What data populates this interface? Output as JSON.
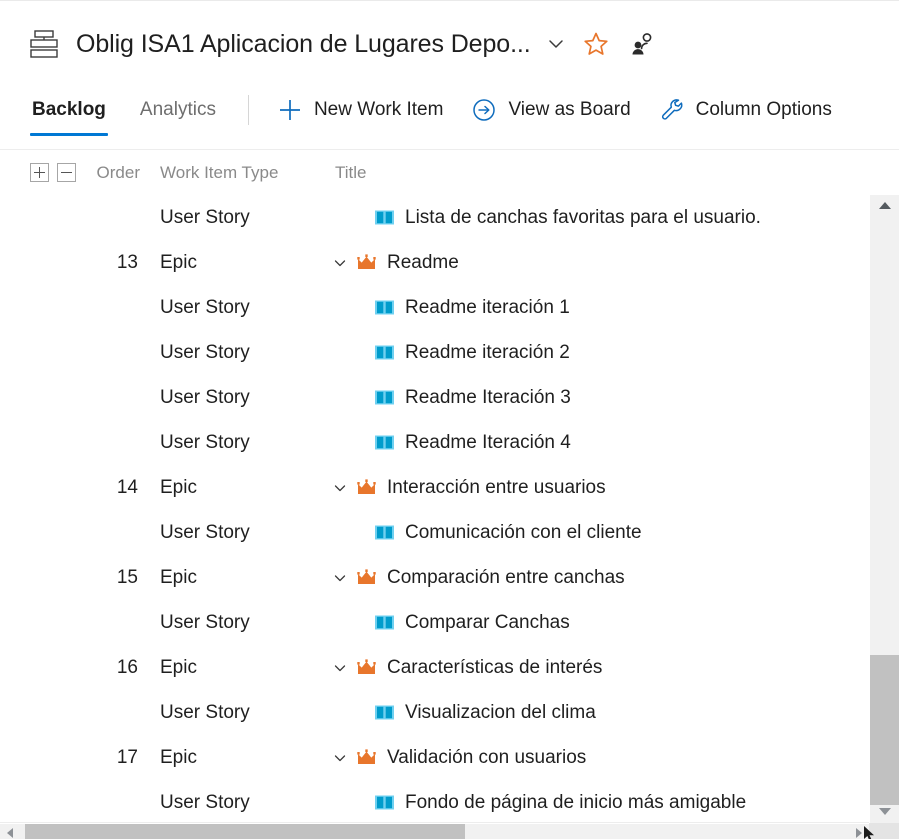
{
  "header": {
    "project_icon": "backlog-stack-icon",
    "title": "Oblig ISA1 Aplicacion de Lugares Depo...",
    "chevron_icon": "chevron-down-icon",
    "favorite_icon": "star-outline-icon",
    "team_icon": "people-icon",
    "favorite_color": "#E8762C"
  },
  "toolbar": {
    "pivots": [
      {
        "label": "Backlog",
        "selected": true
      },
      {
        "label": "Analytics",
        "selected": false
      }
    ],
    "commands": [
      {
        "label": "New Work Item",
        "icon": "plus-icon"
      },
      {
        "label": "View as Board",
        "icon": "circle-arrow-right-icon"
      },
      {
        "label": "Column Options",
        "icon": "wrench-icon"
      }
    ],
    "accent_color": "#0078D4"
  },
  "grid": {
    "expand_all_icon": "expand-all-plus-icon",
    "collapse_all_icon": "collapse-all-minus-icon",
    "columns": [
      {
        "key": "order",
        "label": "Order"
      },
      {
        "key": "type",
        "label": "Work Item Type"
      },
      {
        "key": "title",
        "label": "Title"
      }
    ],
    "rows": [
      {
        "order": "",
        "type": "User Story",
        "title": "Lista de canchas favoritas para el usuario.",
        "level": "story",
        "icon": "user-story-book-icon",
        "expanded": null
      },
      {
        "order": "13",
        "type": "Epic",
        "title": "Readme",
        "level": "epic",
        "icon": "epic-crown-icon",
        "expanded": true
      },
      {
        "order": "",
        "type": "User Story",
        "title": "Readme iteración 1",
        "level": "story",
        "icon": "user-story-book-icon",
        "expanded": null
      },
      {
        "order": "",
        "type": "User Story",
        "title": "Readme iteración 2",
        "level": "story",
        "icon": "user-story-book-icon",
        "expanded": null
      },
      {
        "order": "",
        "type": "User Story",
        "title": "Readme Iteración 3",
        "level": "story",
        "icon": "user-story-book-icon",
        "expanded": null
      },
      {
        "order": "",
        "type": "User Story",
        "title": "Readme Iteración 4",
        "level": "story",
        "icon": "user-story-book-icon",
        "expanded": null
      },
      {
        "order": "14",
        "type": "Epic",
        "title": "Interacción entre usuarios",
        "level": "epic",
        "icon": "epic-crown-icon",
        "expanded": true
      },
      {
        "order": "",
        "type": "User Story",
        "title": "Comunicación con el cliente",
        "level": "story",
        "icon": "user-story-book-icon",
        "expanded": null
      },
      {
        "order": "15",
        "type": "Epic",
        "title": "Comparación entre canchas",
        "level": "epic",
        "icon": "epic-crown-icon",
        "expanded": true
      },
      {
        "order": "",
        "type": "User Story",
        "title": "Comparar Canchas",
        "level": "story",
        "icon": "user-story-book-icon",
        "expanded": null
      },
      {
        "order": "16",
        "type": "Epic",
        "title": "Características de interés",
        "level": "epic",
        "icon": "epic-crown-icon",
        "expanded": true
      },
      {
        "order": "",
        "type": "User Story",
        "title": "Visualizacion del clima",
        "level": "story",
        "icon": "user-story-book-icon",
        "expanded": null
      },
      {
        "order": "17",
        "type": "Epic",
        "title": "Validación con usuarios",
        "level": "epic",
        "icon": "epic-crown-icon",
        "expanded": true
      },
      {
        "order": "",
        "type": "User Story",
        "title": "Fondo de página de inicio más amigable",
        "level": "story",
        "icon": "user-story-book-icon",
        "expanded": null
      }
    ],
    "epic_color": "#E8762C",
    "story_color": "#009CCC"
  },
  "scrollbars": {
    "vertical": {
      "up_icon": "scroll-up-arrow-icon",
      "down_icon": "scroll-down-arrow-icon"
    },
    "horizontal": {
      "left_icon": "scroll-left-arrow-icon",
      "right_icon": "scroll-right-arrow-icon"
    }
  }
}
